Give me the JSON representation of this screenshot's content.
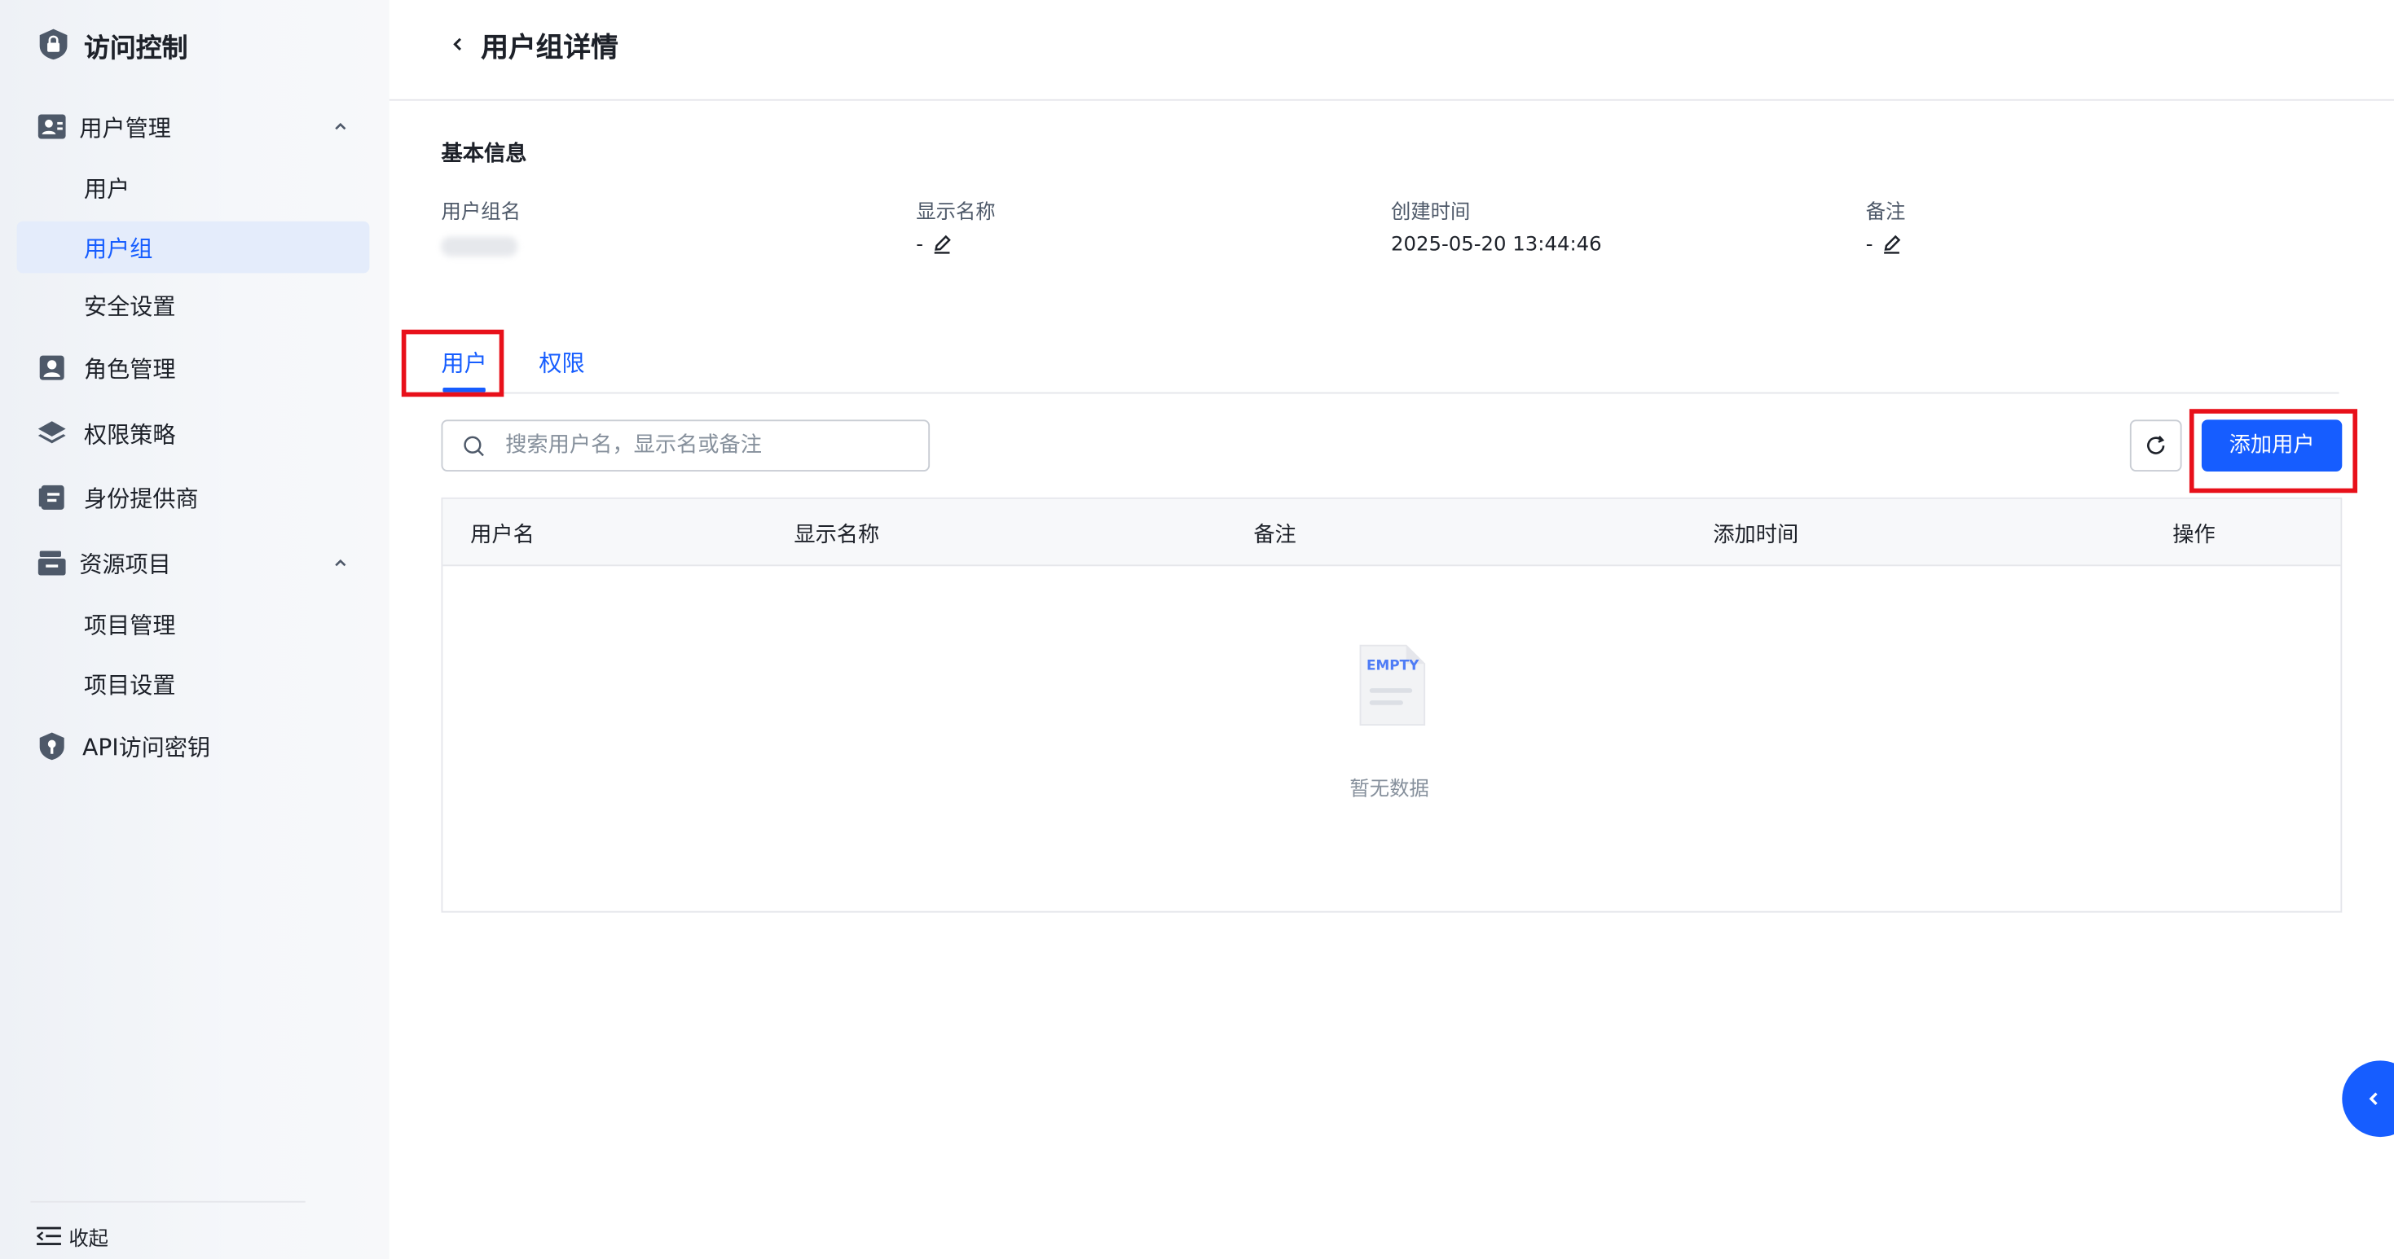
{
  "app": {
    "title": "访问控制",
    "icon": "lock-shield-icon"
  },
  "sidebar": {
    "groups": [
      {
        "label": "用户管理",
        "icon": "users-icon",
        "expanded": true,
        "children": [
          {
            "label": "用户"
          },
          {
            "label": "用户组",
            "active": true
          },
          {
            "label": "安全设置"
          }
        ]
      },
      {
        "label": "角色管理",
        "icon": "role-icon"
      },
      {
        "label": "权限策略",
        "icon": "layers-icon"
      },
      {
        "label": "身份提供商",
        "icon": "identity-icon"
      },
      {
        "label": "资源项目",
        "icon": "folder-icon",
        "expanded": true,
        "children": [
          {
            "label": "项目管理"
          },
          {
            "label": "项目设置"
          }
        ]
      },
      {
        "label": "API访问密钥",
        "icon": "key-shield-icon"
      }
    ],
    "collapse_label": "收起"
  },
  "page": {
    "title": "用户组详情",
    "basic_info": {
      "heading": "基本信息",
      "fields": [
        {
          "label": "用户组名",
          "value": ""
        },
        {
          "label": "显示名称",
          "value": "-"
        },
        {
          "label": "创建时间",
          "value": "2025-05-20 13:44:46"
        },
        {
          "label": "备注",
          "value": "-"
        }
      ]
    },
    "tabs": [
      {
        "label": "用户",
        "active": true
      },
      {
        "label": "权限"
      }
    ],
    "search": {
      "placeholder": "搜索用户名，显示名或备注"
    },
    "add_button": "添加用户",
    "table": {
      "columns": [
        "用户名",
        "显示名称",
        "备注",
        "添加时间",
        "操作"
      ],
      "empty_icon_text": "EMPTY",
      "empty_text": "暂无数据"
    }
  },
  "colors": {
    "primary": "#165dff",
    "highlight": "#e8101a",
    "active_bg": "#e4ecfb"
  }
}
